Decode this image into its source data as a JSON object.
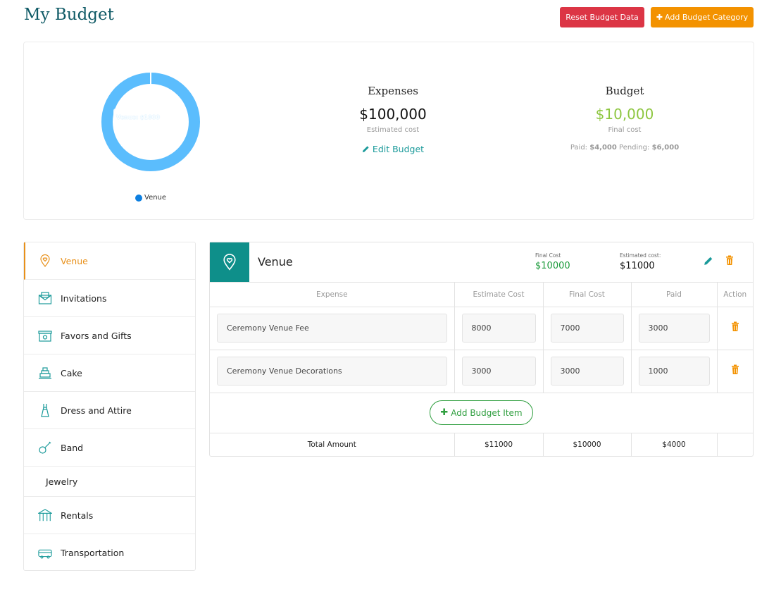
{
  "header": {
    "title": "My Budget",
    "reset_label": "Reset Budget Data",
    "add_category_label": "Add Budget Category"
  },
  "summary": {
    "chart_tooltip": "Venue:   $1000",
    "legend_label": "Venue",
    "expenses": {
      "title": "Expenses",
      "amount": "$100,000",
      "sublabel": "Estimated cost",
      "edit_label": "Edit Budget"
    },
    "budget": {
      "title": "Budget",
      "amount": "$10,000",
      "sublabel": "Final cost",
      "paid_label": "Paid:",
      "paid_value": "$4,000",
      "pending_label": "Pending:",
      "pending_value": "$6,000"
    }
  },
  "colors": {
    "accent_orange": "#f39200",
    "reset_red": "#dc3545",
    "teal": "#0e8f8a",
    "green": "#8dc63f",
    "donut_blue": "#5bbdfd"
  },
  "sidebar": {
    "items": [
      {
        "label": "Venue",
        "icon": "location-pin-icon"
      },
      {
        "label": "Invitations",
        "icon": "envelope-icon"
      },
      {
        "label": "Favors and Gifts",
        "icon": "gift-icon"
      },
      {
        "label": "Cake",
        "icon": "cake-icon"
      },
      {
        "label": "Dress and Attire",
        "icon": "dress-icon"
      },
      {
        "label": "Band",
        "icon": "guitar-icon"
      },
      {
        "label": "Jewelry",
        "icon": ""
      },
      {
        "label": "Rentals",
        "icon": "gazebo-icon"
      },
      {
        "label": "Transportation",
        "icon": "bus-icon"
      }
    ]
  },
  "panel": {
    "title": "Venue",
    "final_cost_label": "Final Cost",
    "final_cost_value": "$10000",
    "estimated_cost_label": "Estimated cost:",
    "estimated_cost_value": "$11000",
    "columns": [
      "Expense",
      "Estimate Cost",
      "Final Cost",
      "Paid",
      "Action"
    ],
    "rows": [
      {
        "expense": "Ceremony Venue Fee",
        "estimate": "8000",
        "final": "7000",
        "paid": "3000"
      },
      {
        "expense": "Ceremony Venue Decorations",
        "estimate": "3000",
        "final": "3000",
        "paid": "1000"
      }
    ],
    "add_item_label": "Add Budget Item",
    "total": {
      "label": "Total Amount",
      "estimate": "$11000",
      "final": "$10000",
      "paid": "$4000"
    }
  }
}
